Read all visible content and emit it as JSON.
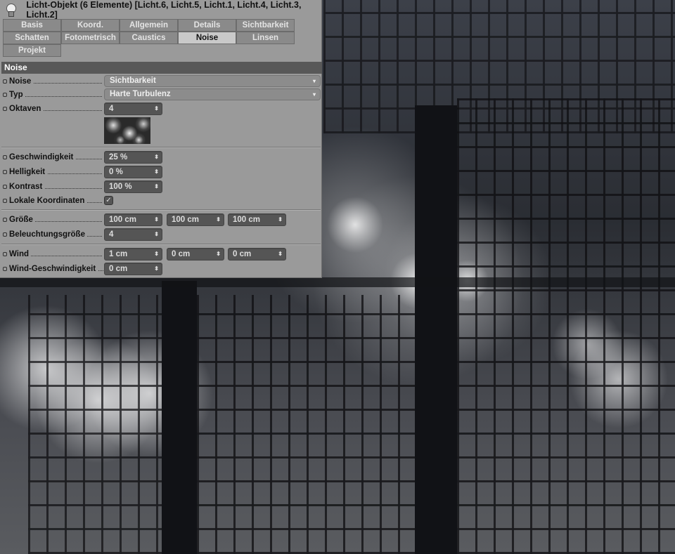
{
  "window": {
    "title": "Licht-Objekt (6 Elemente) [Licht.6, Licht.5, Licht.1, Licht.4, Licht.3, Licht.2]",
    "icon": "light-bulb-icon"
  },
  "tabs": [
    "Basis",
    "Koord.",
    "Allgemein",
    "Details",
    "Sichtbarkeit",
    "Schatten",
    "Fotometrisch",
    "Caustics",
    "Noise",
    "Linsen",
    "Projekt"
  ],
  "active_tab": "Noise",
  "section": "Noise",
  "fields": {
    "noise": {
      "label": "Noise",
      "value": "Sichtbarkeit"
    },
    "typ": {
      "label": "Typ",
      "value": "Harte Turbulenz"
    },
    "oktaven": {
      "label": "Oktaven",
      "value": "4"
    },
    "geschwindigkeit": {
      "label": "Geschwindigkeit",
      "value": "25 %"
    },
    "helligkeit": {
      "label": "Helligkeit",
      "value": "0 %"
    },
    "kontrast": {
      "label": "Kontrast",
      "value": "100 %"
    },
    "lokale": {
      "label": "Lokale Koordinaten",
      "checked": true
    },
    "groesse": {
      "label": "Größe",
      "values": [
        "100 cm",
        "100 cm",
        "100 cm"
      ]
    },
    "beleuchtung": {
      "label": "Beleuchtungsgröße",
      "value": "4"
    },
    "wind": {
      "label": "Wind",
      "values": [
        "1 cm",
        "0 cm",
        "0 cm"
      ]
    },
    "windgeschw": {
      "label": "Wind-Geschwindigkeit",
      "value": "0 cm"
    }
  },
  "icons": {
    "dropdown": "▾",
    "stepper": "⬍",
    "check": "✓"
  }
}
